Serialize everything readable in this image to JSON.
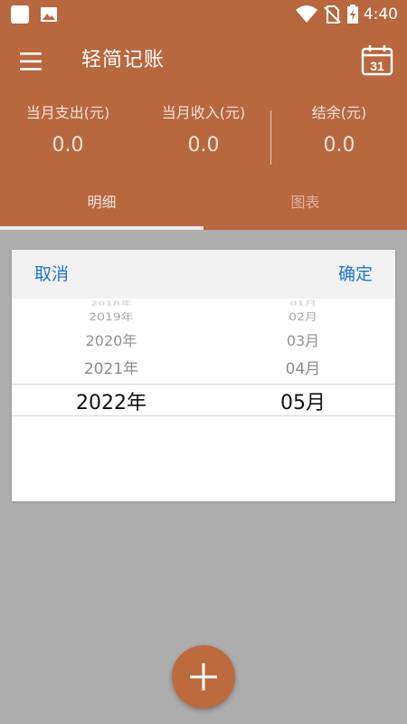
{
  "status_bar": {
    "time": "4:40",
    "icons": [
      "app-square-icon",
      "image-icon",
      "wifi-icon",
      "no-sim-icon",
      "battery-charging-icon"
    ]
  },
  "toolbar": {
    "title": "轻简记账",
    "menu_icon": "menu-icon",
    "calendar_icon": "calendar-icon",
    "calendar_day": "31"
  },
  "summary": {
    "expense_label": "当月支出(元)",
    "expense_value": "0.0",
    "income_label": "当月收入(元)",
    "income_value": "0.0",
    "balance_label": "结余(元)",
    "balance_value": "0.0"
  },
  "tabs": [
    {
      "label": "明细",
      "active": true
    },
    {
      "label": "图表",
      "active": false
    }
  ],
  "date_picker": {
    "cancel_label": "取消",
    "confirm_label": "确定",
    "years": [
      "2018年",
      "2019年",
      "2020年",
      "2021年",
      "2022年"
    ],
    "months": [
      "01月",
      "02月",
      "03月",
      "04月",
      "05月"
    ],
    "selected_year": "2022年",
    "selected_month": "05月"
  },
  "fab": {
    "icon": "plus-icon"
  },
  "colors": {
    "header": "#b8673e",
    "fab": "#bd6a3f",
    "dialog_button": "#1f75c9",
    "scrim": "#adadad"
  }
}
